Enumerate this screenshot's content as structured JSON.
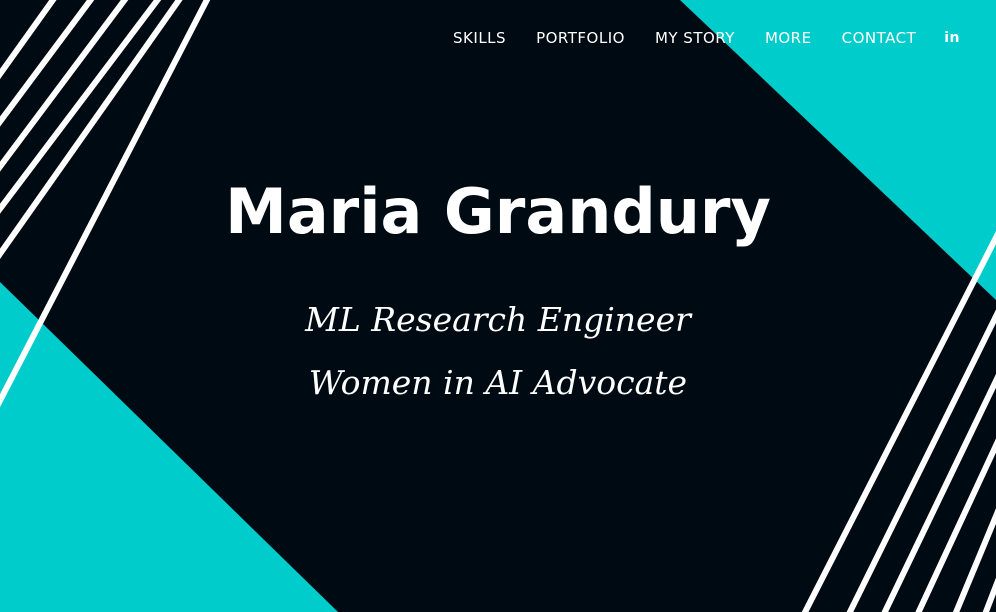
{
  "nav": {
    "items": [
      {
        "label": "SKILLS"
      },
      {
        "label": "PORTFOLIO"
      },
      {
        "label": "MY STORY"
      },
      {
        "label": "MORE"
      },
      {
        "label": "CONTACT"
      }
    ],
    "linkedin_icon_text": "in"
  },
  "hero": {
    "name": "Maria Grandury",
    "role": "ML Research Engineer",
    "tagline": "Women in AI Advocate"
  },
  "colors": {
    "background": "#000a12",
    "accent": "#00cccc",
    "text": "#ffffff"
  }
}
